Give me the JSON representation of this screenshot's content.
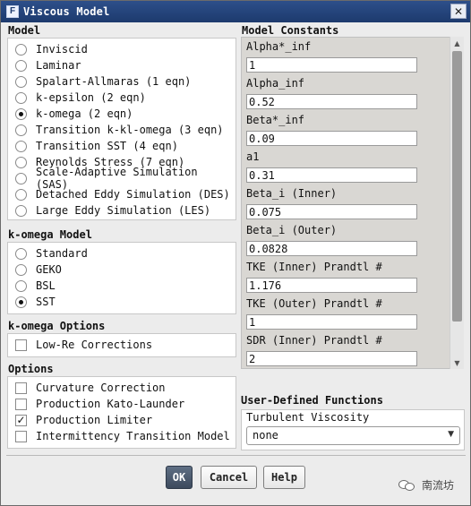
{
  "window": {
    "title": "Viscous Model",
    "app_icon_letter": "F"
  },
  "model": {
    "title": "Model",
    "options": [
      {
        "label": "Inviscid",
        "selected": false
      },
      {
        "label": "Laminar",
        "selected": false
      },
      {
        "label": "Spalart-Allmaras (1 eqn)",
        "selected": false
      },
      {
        "label": "k-epsilon (2 eqn)",
        "selected": false
      },
      {
        "label": "k-omega (2 eqn)",
        "selected": true
      },
      {
        "label": "Transition k-kl-omega (3 eqn)",
        "selected": false
      },
      {
        "label": "Transition SST (4 eqn)",
        "selected": false
      },
      {
        "label": "Reynolds Stress (7 eqn)",
        "selected": false
      },
      {
        "label": "Scale-Adaptive Simulation (SAS)",
        "selected": false
      },
      {
        "label": "Detached Eddy Simulation (DES)",
        "selected": false
      },
      {
        "label": "Large Eddy Simulation (LES)",
        "selected": false
      }
    ]
  },
  "komega_model": {
    "title": "k-omega Model",
    "options": [
      {
        "label": "Standard",
        "selected": false
      },
      {
        "label": "GEKO",
        "selected": false
      },
      {
        "label": "BSL",
        "selected": false
      },
      {
        "label": "SST",
        "selected": true
      }
    ]
  },
  "komega_options": {
    "title": "k-omega Options",
    "items": [
      {
        "label": "Low-Re Corrections",
        "checked": false
      }
    ]
  },
  "options": {
    "title": "Options",
    "items": [
      {
        "label": "Curvature Correction",
        "checked": false
      },
      {
        "label": "Production Kato-Launder",
        "checked": false
      },
      {
        "label": "Production Limiter",
        "checked": true
      },
      {
        "label": "Intermittency Transition Model",
        "checked": false
      }
    ]
  },
  "constants": {
    "title": "Model Constants",
    "items": [
      {
        "label": "Alpha*_inf",
        "value": "1"
      },
      {
        "label": "Alpha_inf",
        "value": "0.52"
      },
      {
        "label": "Beta*_inf",
        "value": "0.09"
      },
      {
        "label": "a1",
        "value": "0.31"
      },
      {
        "label": "Beta_i (Inner)",
        "value": "0.075"
      },
      {
        "label": "Beta_i (Outer)",
        "value": "0.0828"
      },
      {
        "label": "TKE (Inner) Prandtl #",
        "value": "1.176"
      },
      {
        "label": "TKE (Outer) Prandtl #",
        "value": "1"
      },
      {
        "label": "SDR (Inner) Prandtl #",
        "value": "2"
      }
    ]
  },
  "udf": {
    "title": "User-Defined Functions",
    "field_label": "Turbulent Viscosity",
    "selected": "none"
  },
  "buttons": {
    "ok": "OK",
    "cancel": "Cancel",
    "help": "Help"
  },
  "watermark": {
    "text": "南流坊"
  },
  "icons": {
    "close": "close-icon",
    "check": "check-icon",
    "dropdown": "chevron-down-icon",
    "scroll_up": "arrow-up-icon",
    "scroll_down": "arrow-down-icon",
    "app": "fluent-app-icon"
  }
}
